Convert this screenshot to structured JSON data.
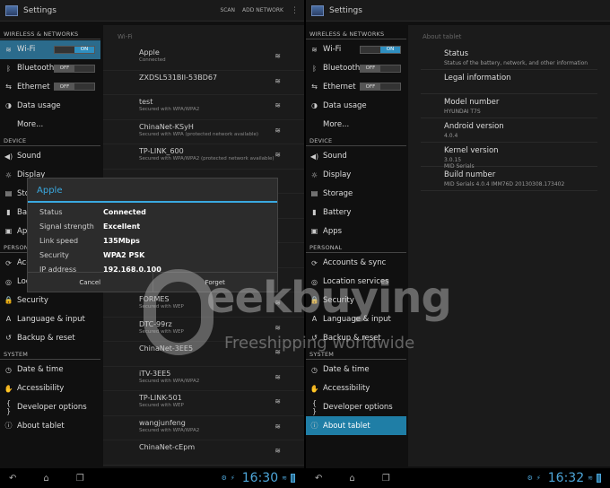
{
  "left": {
    "title": "Settings",
    "actions": {
      "scan": "SCAN",
      "add_network": "ADD NETWORK"
    },
    "crumb": "Wi-Fi",
    "sections": [
      {
        "header": "WIRELESS & NETWORKS",
        "items": [
          {
            "label": "Wi-Fi",
            "icon": "wifi-icon",
            "glyph": "≋",
            "toggle": "ON",
            "selected": true
          },
          {
            "label": "Bluetooth",
            "icon": "bluetooth-icon",
            "glyph": "ᛒ",
            "toggle": "OFF"
          },
          {
            "label": "Ethernet",
            "icon": "ethernet-icon",
            "glyph": "⇆",
            "toggle": "OFF"
          },
          {
            "label": "Data usage",
            "icon": "data-usage-icon",
            "glyph": "◑"
          },
          {
            "label": "More...",
            "icon": "",
            "glyph": ""
          }
        ]
      },
      {
        "header": "DEVICE",
        "items": [
          {
            "label": "Sound",
            "icon": "sound-icon",
            "glyph": "◀)"
          },
          {
            "label": "Display",
            "icon": "display-icon",
            "glyph": "☼"
          },
          {
            "label": "Storage",
            "icon": "storage-icon",
            "glyph": "▤"
          },
          {
            "label": "Battery",
            "icon": "battery-icon",
            "glyph": "▮"
          },
          {
            "label": "Apps",
            "icon": "apps-icon",
            "glyph": "▣"
          }
        ]
      },
      {
        "header": "PERSONAL",
        "items": [
          {
            "label": "Accounts & sync",
            "icon": "sync-icon",
            "glyph": "⟳"
          },
          {
            "label": "Location services",
            "icon": "location-icon",
            "glyph": "◎"
          },
          {
            "label": "Security",
            "icon": "lock-icon",
            "glyph": "🔒"
          },
          {
            "label": "Language & input",
            "icon": "language-icon",
            "glyph": "A"
          },
          {
            "label": "Backup & reset",
            "icon": "backup-icon",
            "glyph": "↺"
          }
        ]
      },
      {
        "header": "SYSTEM",
        "items": [
          {
            "label": "Date & time",
            "icon": "clock-icon",
            "glyph": "◷"
          },
          {
            "label": "Accessibility",
            "icon": "accessibility-icon",
            "glyph": "✋"
          },
          {
            "label": "Developer options",
            "icon": "developer-icon",
            "glyph": "{ }"
          },
          {
            "label": "About tablet",
            "icon": "info-icon",
            "glyph": "ⓘ"
          }
        ]
      }
    ],
    "networks": [
      {
        "name": "Apple",
        "sub": "Connected"
      },
      {
        "name": "ZXDSL531BII-53BD67",
        "sub": ""
      },
      {
        "name": "test",
        "sub": "Secured with WPA/WPA2"
      },
      {
        "name": "ChinaNet-KSyH",
        "sub": "Secured with WPA (protected network available)"
      },
      {
        "name": "TP-LINK_600",
        "sub": "Secured with WPA/WPA2 (protected network available)"
      },
      {
        "name": "",
        "sub": ""
      },
      {
        "name": "",
        "sub": ""
      },
      {
        "name": "",
        "sub": ""
      },
      {
        "name": "",
        "sub": ""
      },
      {
        "name": "",
        "sub": "Secured with WPA/WPA2"
      },
      {
        "name": "FORMES",
        "sub": "Secured with WEP"
      },
      {
        "name": "DTC-99rz",
        "sub": "Secured with WEP"
      },
      {
        "name": "ChinaNet-3EE5",
        "sub": ""
      },
      {
        "name": "iTV-3EE5",
        "sub": "Secured with WPA/WPA2"
      },
      {
        "name": "TP-LINK-501",
        "sub": "Secured with WEP"
      },
      {
        "name": "wangjunfeng",
        "sub": "Secured with WPA/WPA2"
      },
      {
        "name": "ChinaNet-cEpm",
        "sub": ""
      }
    ],
    "dialog": {
      "title": "Apple",
      "rows": [
        {
          "label": "Status",
          "value": "Connected"
        },
        {
          "label": "Signal strength",
          "value": "Excellent"
        },
        {
          "label": "Link speed",
          "value": "135Mbps"
        },
        {
          "label": "Security",
          "value": "WPA2 PSK"
        },
        {
          "label": "IP address",
          "value": "192.168.0.100"
        }
      ],
      "cancel": "Cancel",
      "forget": "Forget"
    },
    "clock": "16:30"
  },
  "right": {
    "title": "Settings",
    "crumb": "About tablet",
    "sections": [
      {
        "header": "WIRELESS & NETWORKS",
        "items": [
          {
            "label": "Wi-Fi",
            "icon": "wifi-icon",
            "glyph": "≋",
            "toggle": "ON"
          },
          {
            "label": "Bluetooth",
            "icon": "bluetooth-icon",
            "glyph": "ᛒ",
            "toggle": "OFF"
          },
          {
            "label": "Ethernet",
            "icon": "ethernet-icon",
            "glyph": "⇆",
            "toggle": "OFF"
          },
          {
            "label": "Data usage",
            "icon": "data-usage-icon",
            "glyph": "◑"
          },
          {
            "label": "More...",
            "icon": "",
            "glyph": ""
          }
        ]
      },
      {
        "header": "DEVICE",
        "items": [
          {
            "label": "Sound",
            "icon": "sound-icon",
            "glyph": "◀)"
          },
          {
            "label": "Display",
            "icon": "display-icon",
            "glyph": "☼"
          },
          {
            "label": "Storage",
            "icon": "storage-icon",
            "glyph": "▤"
          },
          {
            "label": "Battery",
            "icon": "battery-icon",
            "glyph": "▮"
          },
          {
            "label": "Apps",
            "icon": "apps-icon",
            "glyph": "▣"
          }
        ]
      },
      {
        "header": "PERSONAL",
        "items": [
          {
            "label": "Accounts & sync",
            "icon": "sync-icon",
            "glyph": "⟳"
          },
          {
            "label": "Location services",
            "icon": "location-icon",
            "glyph": "◎"
          },
          {
            "label": "Security",
            "icon": "lock-icon",
            "glyph": "🔒"
          },
          {
            "label": "Language & input",
            "icon": "language-icon",
            "glyph": "A"
          },
          {
            "label": "Backup & reset",
            "icon": "backup-icon",
            "glyph": "↺"
          }
        ]
      },
      {
        "header": "SYSTEM",
        "items": [
          {
            "label": "Date & time",
            "icon": "clock-icon",
            "glyph": "◷"
          },
          {
            "label": "Accessibility",
            "icon": "accessibility-icon",
            "glyph": "✋"
          },
          {
            "label": "Developer options",
            "icon": "developer-icon",
            "glyph": "{ }"
          },
          {
            "label": "About tablet",
            "icon": "info-icon",
            "glyph": "ⓘ",
            "active": true
          }
        ]
      }
    ],
    "about": [
      {
        "title": "Status",
        "sub": "Status of the battery, network, and other information"
      },
      {
        "title": "Legal information",
        "sub": ""
      },
      {
        "title": "Model number",
        "sub": "HYUNDAI T7S"
      },
      {
        "title": "Android version",
        "sub": "4.0.4"
      },
      {
        "title": "Kernel version",
        "sub": "3.0.15\nMID Serials"
      },
      {
        "title": "Build number",
        "sub": "MID Serials 4.0.4 IMM76D 20130308.173402"
      }
    ],
    "clock": "16:32"
  },
  "watermark": {
    "brand": "eekbuying",
    "tagline": "Freeshipping worldwide"
  },
  "colors": {
    "accent": "#3aa9e0",
    "selected": "#1f7ea6"
  }
}
